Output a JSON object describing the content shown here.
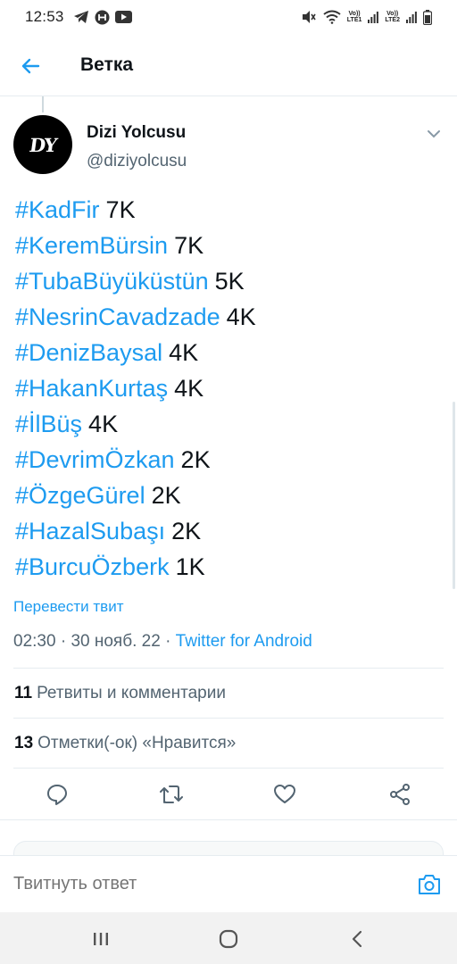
{
  "status_bar": {
    "time": "12:53",
    "net1": [
      "Vo))",
      "LTE1"
    ],
    "net2": [
      "Vo))",
      "LTE2"
    ]
  },
  "header": {
    "title": "Ветка"
  },
  "tweet": {
    "author_name": "Dizi Yolcusu",
    "author_handle": "@diziyolcusu",
    "avatar_text": "DY",
    "lines": [
      {
        "tag": "#KadFir",
        "count": "7K"
      },
      {
        "tag": "#KeremBürsin",
        "count": "7K"
      },
      {
        "tag": "#TubaBüyüküstün",
        "count": "5K"
      },
      {
        "tag": "#NesrinCavadzade",
        "count": "4K"
      },
      {
        "tag": "#DenizBaysal",
        "count": "4K"
      },
      {
        "tag": "#HakanKurtaş",
        "count": "4K"
      },
      {
        "tag": "#İlBüş",
        "count": "4K"
      },
      {
        "tag": "#DevrimÖzkan",
        "count": "2K"
      },
      {
        "tag": "#ÖzgeGürel",
        "count": "2K"
      },
      {
        "tag": "#HazalSubaşı",
        "count": "2K"
      },
      {
        "tag": "#BurcuÖzberk",
        "count": "1K"
      }
    ],
    "translate_label": "Перевести твит",
    "time": "02:30",
    "date": "30 нояб. 22",
    "separator": "·",
    "source": "Twitter for Android",
    "retweets_count": "11",
    "retweets_label": "Ретвиты и комментарии",
    "likes_count": "13",
    "likes_label": "Отметки(-ок) «Нравится»"
  },
  "reply": {
    "placeholder": "Твитнуть ответ"
  },
  "icons": {
    "back": "arrow-left-icon",
    "more": "chevron-down-icon",
    "reply": "comment-icon",
    "retweet": "retweet-icon",
    "like": "heart-icon",
    "share": "share-icon",
    "camera": "camera-icon"
  },
  "colors": {
    "accent": "#1d9bf0",
    "text_primary": "#0f1419",
    "text_secondary": "#536471",
    "divider": "#e6ecf0"
  }
}
